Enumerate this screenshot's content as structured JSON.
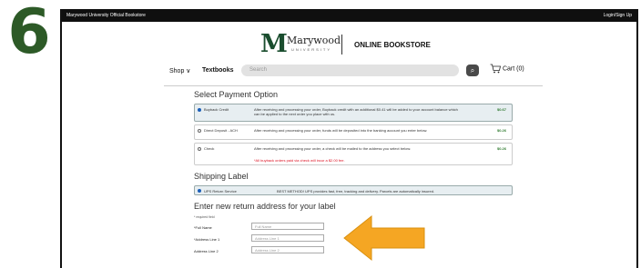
{
  "step": "6",
  "topbar": {
    "store_name": "Marywood University Official Bookstore",
    "login": "Login/Sign Up"
  },
  "logo": {
    "letter": "M",
    "name": "Marywood",
    "subtitle": "UNIVERSITY",
    "online": "ONLINE BOOKSTORE"
  },
  "nav": {
    "shop": "Shop ∨",
    "textbooks": "Textbooks",
    "search_placeholder": "Search",
    "cart": "Cart (0)"
  },
  "payment": {
    "title": "Select Payment Option",
    "options": [
      {
        "label": "Buyback Credit",
        "desc": "After receiving and processing your order, Buyback credit with an additional $0.41 will be added to your account balance which can be applied to the next order you place with us.",
        "amount": "$0.67",
        "selected": true
      },
      {
        "label": "Direct Deposit - ACH",
        "desc": "After receiving and processing your order, funds will be deposited into the banking account you enter below.",
        "amount": "$0.26",
        "selected": false
      },
      {
        "label": "Check",
        "desc": "After receiving and processing your order, a check will be mailed to the address you select below.",
        "amount": "$0.26",
        "warning": "*All buyback orders paid via check will incur a $2.00 fee.",
        "selected": false
      }
    ]
  },
  "shipping": {
    "title": "Shipping Label",
    "option": {
      "label": "UPS Return Service",
      "desc": "BEST METHOD! UPS provides fast, free, tracking and delivery. Parcels are automatically insured."
    }
  },
  "address": {
    "title": "Enter new return address for your label",
    "required_note": "* required field",
    "fields": [
      {
        "label": "*Full Name",
        "placeholder": "Full Name"
      },
      {
        "label": "*Address Line 1",
        "placeholder": "Address Line 1"
      },
      {
        "label": "Address Line 2",
        "placeholder": "Address Line 2"
      }
    ]
  },
  "colors": {
    "step": "#2d5a27",
    "arrow": "#f5a623",
    "logo": "#1a4d2e",
    "amount": "#2f7a2f"
  }
}
